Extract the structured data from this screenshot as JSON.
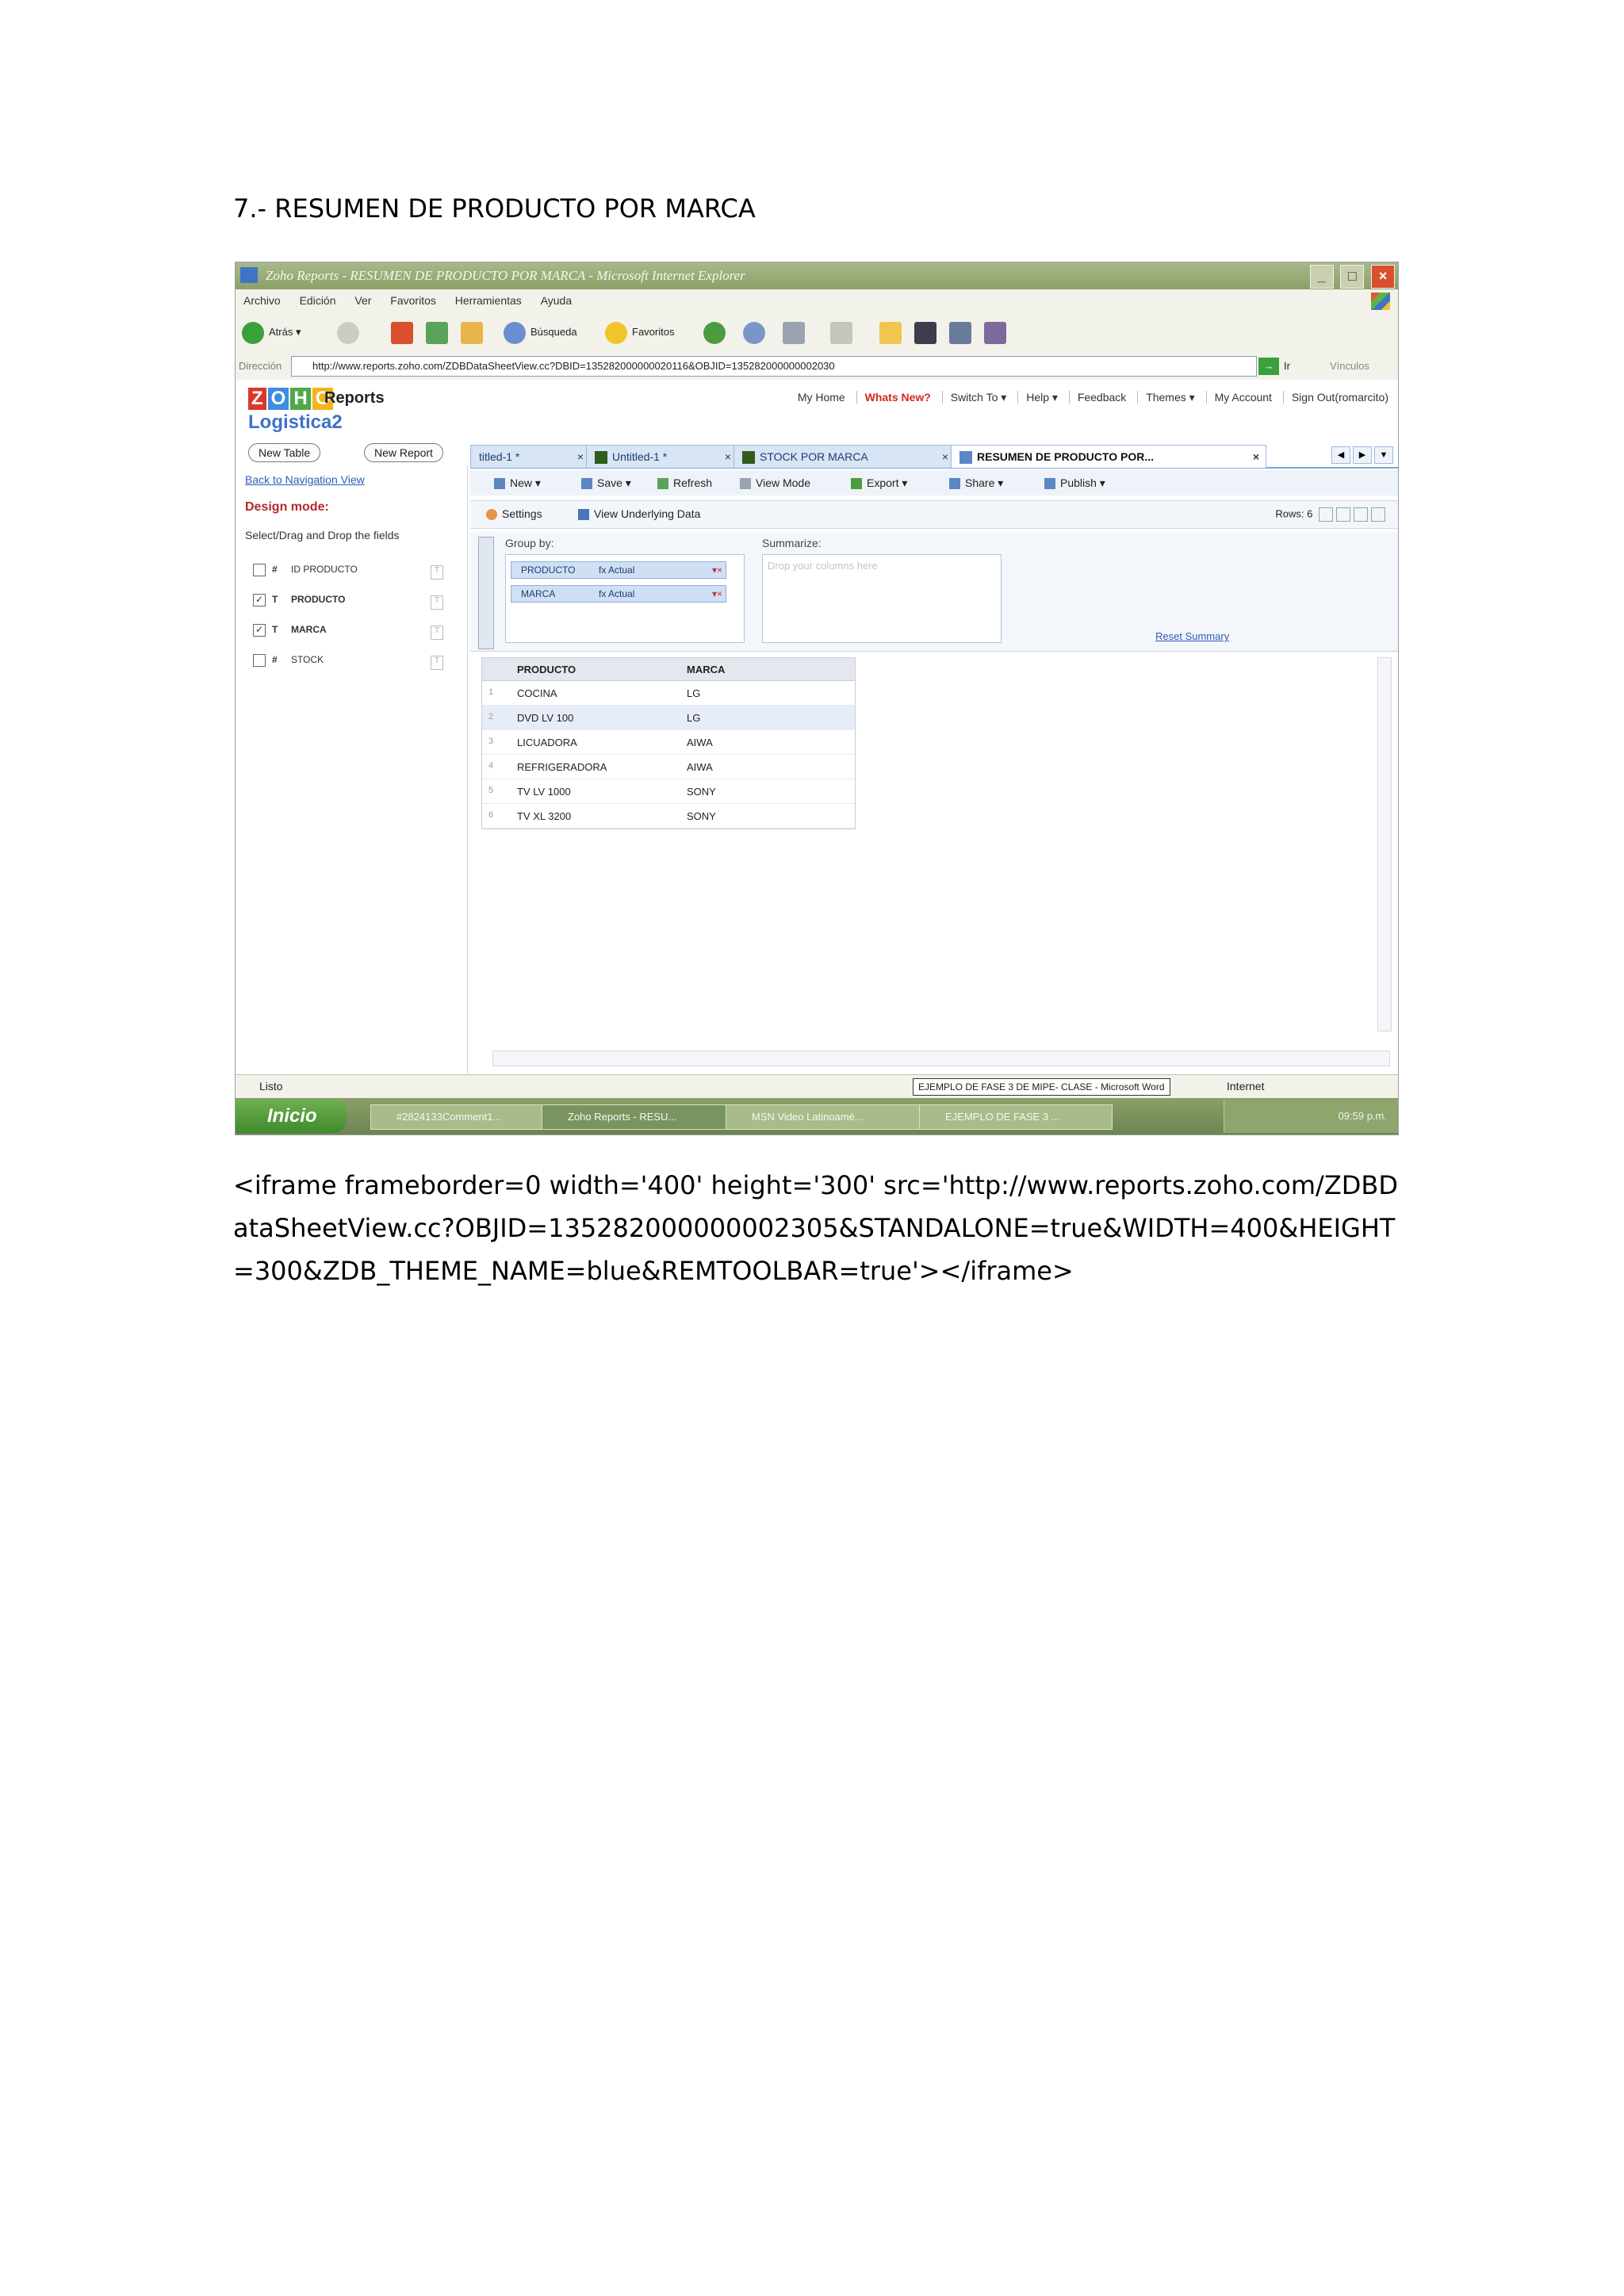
{
  "heading": "7.- RESUMEN DE PRODUCTO POR MARCA",
  "browser": {
    "title": "Zoho Reports - RESUMEN DE PRODUCTO POR MARCA - Microsoft Internet Explorer",
    "menu": [
      "Archivo",
      "Edición",
      "Ver",
      "Favoritos",
      "Herramientas",
      "Ayuda"
    ],
    "toolbar": {
      "back": "Atrás",
      "search": "Búsqueda",
      "favorites": "Favoritos"
    },
    "address_label": "Dirección",
    "url": "http://www.reports.zoho.com/ZDBDataSheetView.cc?DBID=135282000000020116&OBJID=135282000000002030",
    "go": "Ir",
    "links": "Vínculos"
  },
  "zoho": {
    "logo": [
      "Z",
      "O",
      "H",
      "O"
    ],
    "product": "Reports",
    "database": "Logistica2",
    "topnav": [
      "My Home",
      "Whats New?",
      "Switch To ▾",
      "Help ▾",
      "Feedback",
      "Themes ▾",
      "My Account",
      "Sign Out(romarcito)"
    ],
    "new_table": "New Table",
    "new_report": "New Report",
    "back_link": "Back to Navigation View",
    "design_mode": "Design mode:",
    "instructions": "Select/Drag and Drop the fields",
    "fields": [
      {
        "type": "#",
        "name": "ID PRODUCTO",
        "checked": false
      },
      {
        "type": "T",
        "name": "PRODUCTO",
        "checked": true
      },
      {
        "type": "T",
        "name": "MARCA",
        "checked": true
      },
      {
        "type": "#",
        "name": "STOCK",
        "checked": false
      }
    ],
    "tabs": [
      "titled-1 *",
      "Untitled-1 *",
      "STOCK POR MARCA",
      "RESUMEN DE PRODUCTO POR..."
    ],
    "actions": [
      "New ▾",
      "Save ▾",
      "Refresh",
      "View Mode",
      "Export ▾",
      "Share ▾",
      "Publish ▾"
    ],
    "settings": "Settings",
    "view_underlying": "View Underlying Data",
    "rows_label": "Rows: 6",
    "group_by": "Group by:",
    "summarize": "Summarize:",
    "group_chips": [
      {
        "name": "PRODUCTO",
        "fn": "fx Actual"
      },
      {
        "name": "MARCA",
        "fn": "fx Actual"
      }
    ],
    "drop_placeholder": "Drop your columns here",
    "reset_summary": "Reset Summary",
    "grid": {
      "headers": [
        "PRODUCTO",
        "MARCA"
      ],
      "rows": [
        [
          "1",
          "COCINA",
          "LG"
        ],
        [
          "2",
          "DVD LV 100",
          "LG"
        ],
        [
          "3",
          "LICUADORA",
          "AIWA"
        ],
        [
          "4",
          "REFRIGERADORA",
          "AIWA"
        ],
        [
          "5",
          "TV LV 1000",
          "SONY"
        ],
        [
          "6",
          "TV XL 3200",
          "SONY"
        ]
      ]
    }
  },
  "status": {
    "done": "Listo",
    "word_tooltip": "EJEMPLO DE FASE 3 DE MIPE- CLASE - Microsoft Word",
    "zone": "Internet"
  },
  "taskbar": {
    "start": "Inicio",
    "tasks": [
      "#2824133Comment1...",
      "Zoho Reports - RESU...",
      "MSN Video Latinoamé...",
      "EJEMPLO DE FASE 3 ..."
    ],
    "clock": "09:59 p.m."
  },
  "code_text": "<iframe frameborder=0 width='400' height='300' src='http://www.reports.zoho.com/ZDBDataSheetView.cc?OBJID=135282000000002305&STANDALONE=true&WIDTH=400&HEIGHT=300&ZDB_THEME_NAME=blue&REMTOOLBAR=true'></iframe>",
  "colors": {
    "accent": "#3e71c9",
    "design_mode": "#b3282d",
    "whats_new": "#d0281d"
  }
}
